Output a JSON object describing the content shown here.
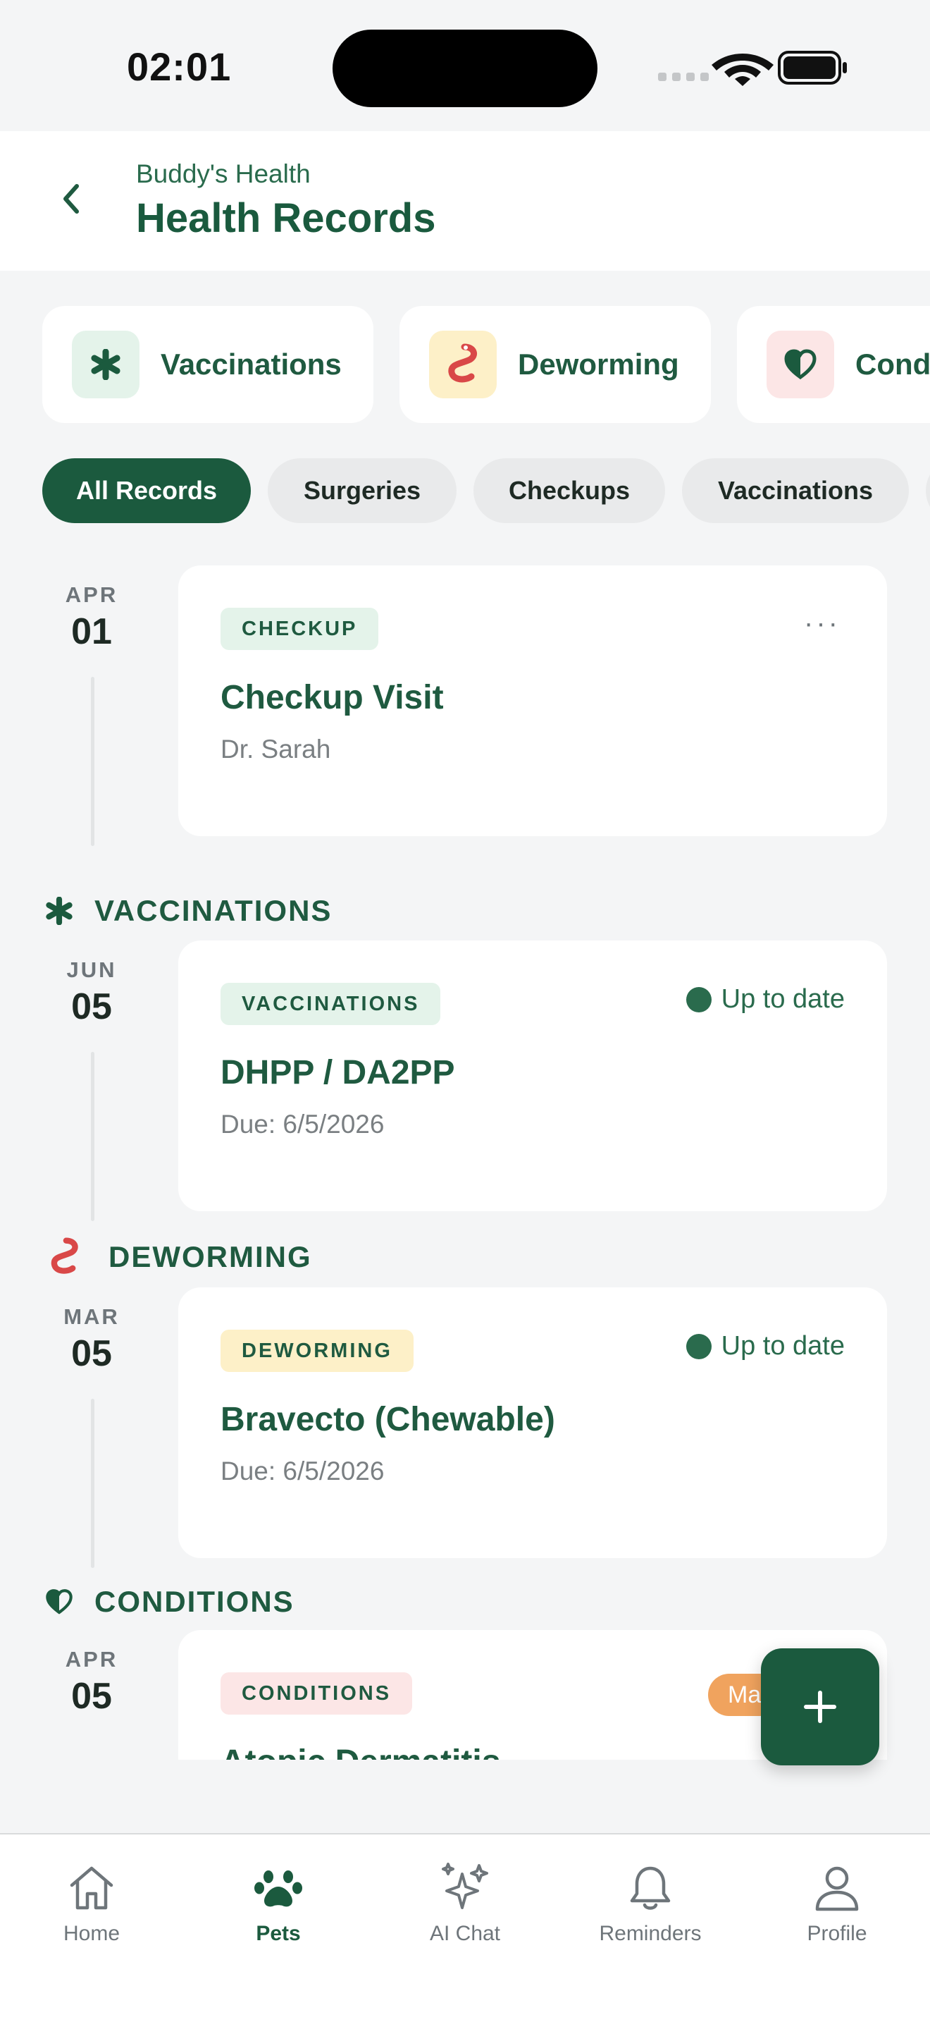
{
  "status_bar": {
    "time": "02:01"
  },
  "header": {
    "subtitle": "Buddy's Health",
    "title": "Health Records"
  },
  "categories": [
    {
      "label": "Vaccinations",
      "icon": "asterisk-icon",
      "bg": "#e4f3ea"
    },
    {
      "label": "Deworming",
      "icon": "worm-icon",
      "bg": "#fdf0c8"
    },
    {
      "label": "Conditions",
      "icon": "heart-shield-icon",
      "bg": "#fce6e6"
    }
  ],
  "filters": [
    "All Records",
    "Surgeries",
    "Checkups",
    "Vaccinations"
  ],
  "records": [
    {
      "month": "APR",
      "day": "01",
      "badge": "CHECKUP",
      "badge_bg": "#e4f3ea",
      "title": "Checkup Visit",
      "subtitle": "Dr. Sarah",
      "more": "···"
    },
    {
      "section": "VACCINATIONS",
      "month": "JUN",
      "day": "05",
      "badge": "VACCINATIONS",
      "badge_bg": "#e4f3ea",
      "title": "DHPP / DA2PP",
      "subtitle": "Due: 6/5/2026",
      "status": "Up to date"
    },
    {
      "section": "DEWORMING",
      "month": "MAR",
      "day": "05",
      "badge": "DEWORMING",
      "badge_bg": "#fdf0c8",
      "title": "Bravecto (Chewable)",
      "subtitle": "Due: 6/5/2026",
      "status": "Up to date"
    },
    {
      "section": "CONDITIONS",
      "month": "APR",
      "day": "05",
      "badge": "CONDITIONS",
      "badge_bg": "#fce6e6",
      "title": "Atopic Dermatitis",
      "status_pill": "Ma"
    }
  ],
  "tabs": [
    {
      "label": "Home",
      "icon": "home-icon"
    },
    {
      "label": "Pets",
      "icon": "paw-icon",
      "active": true
    },
    {
      "label": "AI Chat",
      "icon": "sparkles-icon"
    },
    {
      "label": "Reminders",
      "icon": "bell-icon"
    },
    {
      "label": "Profile",
      "icon": "person-icon"
    }
  ],
  "colors": {
    "brand": "#1b5a3e",
    "background": "#f4f5f6",
    "pill_orange": "#f0a35e"
  }
}
